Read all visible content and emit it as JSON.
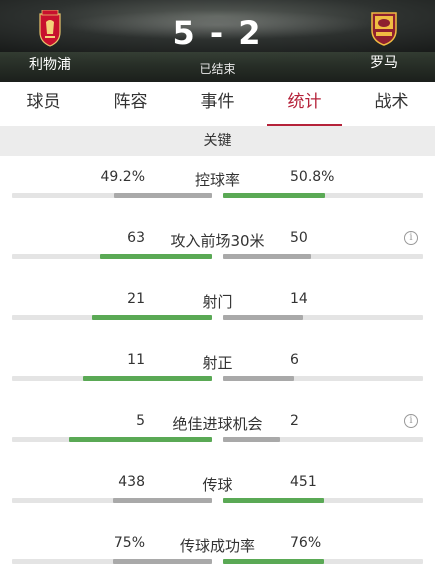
{
  "match": {
    "home_team": "利物浦",
    "away_team": "罗马",
    "score": "5 - 2",
    "status": "已结束"
  },
  "tabs": [
    {
      "label": "球员",
      "active": false
    },
    {
      "label": "阵容",
      "active": false
    },
    {
      "label": "事件",
      "active": false
    },
    {
      "label": "统计",
      "active": true
    },
    {
      "label": "战术",
      "active": false
    }
  ],
  "section": {
    "title": "关键"
  },
  "stats": [
    {
      "label": "控球率",
      "home": "49.2%",
      "away": "50.8%",
      "home_share": 0.492,
      "away_share": 0.508,
      "leader": "away",
      "info": false
    },
    {
      "label": "攻入前场30米",
      "home": "63",
      "away": "50",
      "home_share": 0.558,
      "away_share": 0.442,
      "leader": "home",
      "info": true
    },
    {
      "label": "射门",
      "home": "21",
      "away": "14",
      "home_share": 0.6,
      "away_share": 0.4,
      "leader": "home",
      "info": false
    },
    {
      "label": "射正",
      "home": "11",
      "away": "6",
      "home_share": 0.647,
      "away_share": 0.353,
      "leader": "home",
      "info": false
    },
    {
      "label": "绝佳进球机会",
      "home": "5",
      "away": "2",
      "home_share": 0.714,
      "away_share": 0.286,
      "leader": "home",
      "info": true
    },
    {
      "label": "传球",
      "home": "438",
      "away": "451",
      "home_share": 0.493,
      "away_share": 0.507,
      "leader": "away",
      "info": false
    },
    {
      "label": "传球成功率",
      "home": "75%",
      "away": "76%",
      "home_share": 0.497,
      "away_share": 0.503,
      "leader": "away",
      "info": false
    }
  ],
  "colors": {
    "accent": "#b5223a",
    "leading_bar": "#5aa955",
    "trailing_bar": "#a9a9a9",
    "liverpool_red": "#c8102e",
    "roma_gold": "#f0bc42",
    "roma_maroon": "#8e1f2f"
  },
  "icons": {
    "info": "info-circle-icon",
    "home_crest": "liverpool-crest-icon",
    "away_crest": "roma-crest-icon"
  }
}
